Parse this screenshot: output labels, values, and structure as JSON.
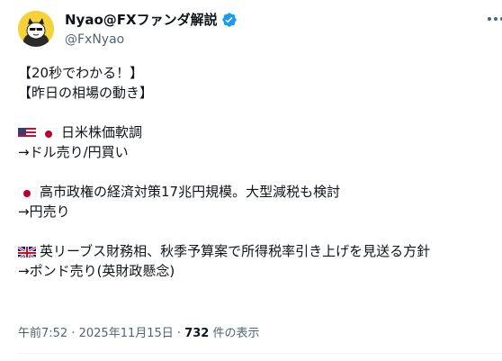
{
  "author": {
    "display_name": "Nyao@FXファンダ解説",
    "handle": "@FxNyao"
  },
  "post": {
    "lines": [
      "【20秒でわかる！】",
      "【昨日の相場の動き】",
      "",
      "日米株価軟調",
      "→ドル売り/円買い",
      "",
      "高市政権の経済対策17兆円規模。大型減税も検討",
      "→円売り",
      "",
      "英リーブス財務相、秋季予算案で所得税率引き上げを見送る方針",
      "→ポンド売り(英財政懸念)"
    ]
  },
  "meta": {
    "time": "午前7:52",
    "sep1": " · ",
    "date": "2025年11月15日",
    "sep2": " · ",
    "views_count": "732",
    "views_label": " 件の表示"
  },
  "icons": {
    "verified": "verified-badge-icon",
    "more": "more-icon",
    "flags": [
      "us-flag-icon",
      "jp-flag-icon",
      "uk-flag-icon"
    ]
  },
  "colors": {
    "verified_blue": "#1d9bf0",
    "secondary_text": "#536471",
    "primary_text": "#0f1419"
  }
}
